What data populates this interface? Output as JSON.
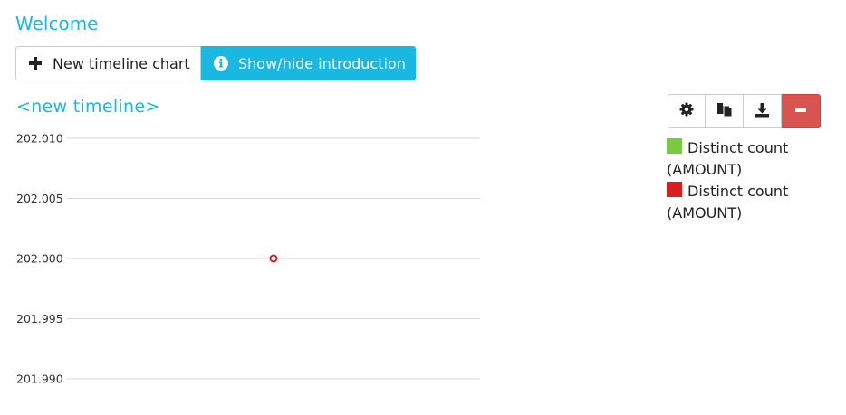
{
  "header": {
    "title": "Welcome"
  },
  "actions": {
    "new_chart_label": "New timeline chart",
    "toggle_intro_label": "Show/hide introduction"
  },
  "timeline": {
    "title": "<new timeline>"
  },
  "toolbar": {
    "settings_icon": "gear-icon",
    "copy_icon": "copy-icon",
    "download_icon": "download-icon",
    "remove_icon": "minus-icon"
  },
  "colors": {
    "accent": "#1ab8e0",
    "danger": "#d9534f",
    "series_green": "#7ac943",
    "series_red": "#d42020"
  },
  "legend": [
    {
      "label": "Distinct count (AMOUNT)",
      "color": "#7ac943"
    },
    {
      "label": "Distinct count (AMOUNT)",
      "color": "#d42020"
    }
  ],
  "chart_data": {
    "type": "scatter",
    "title": "",
    "ylabels": [
      "202.010",
      "202.005",
      "202.000",
      "201.995",
      "201.990"
    ],
    "yticks": [
      202.01,
      202.005,
      202.0,
      201.995,
      201.99
    ],
    "ylim": [
      201.99,
      202.01
    ],
    "grid": true,
    "legend_position": "right",
    "series": [
      {
        "name": "Distinct count (AMOUNT)",
        "color": "#d42020",
        "points": [
          {
            "x": 0.5,
            "y": 202.0
          }
        ]
      }
    ],
    "xlim": [
      0,
      1
    ]
  }
}
